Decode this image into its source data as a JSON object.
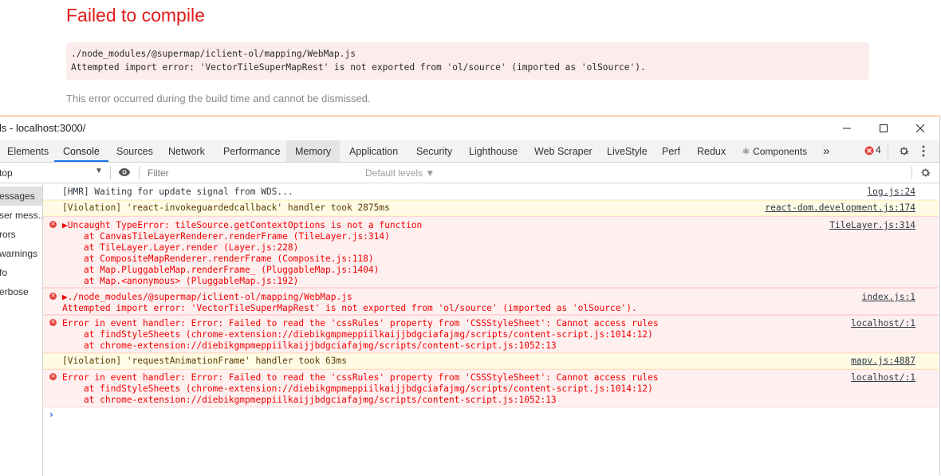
{
  "overlay": {
    "title": "Failed to compile",
    "error_lines": [
      "./node_modules/@supermap/iclient-ol/mapping/WebMap.js",
      "Attempted import error: 'VectorTileSuperMapRest' is not exported from 'ol/source' (imported as 'olSource')."
    ],
    "note": "This error occurred during the build time and cannot be dismissed."
  },
  "window": {
    "title": "ls - localhost:3000/",
    "controls": {
      "minimize": "—",
      "maximize": "☐",
      "close": "✕"
    }
  },
  "tabs": [
    "Elements",
    "Console",
    "Sources",
    "Network",
    "Performance",
    "Memory",
    "Application",
    "Security",
    "Lighthouse",
    "Web Scraper",
    "LiveStyle",
    "Perf",
    "Redux",
    "⚛ Components",
    "»"
  ],
  "active_tab": "Console",
  "error_count": "4",
  "filter": {
    "context": "top",
    "placeholder": "Filter",
    "levels": "Default levels ▼"
  },
  "sidebar": [
    "essages",
    "ser mess...",
    "rors",
    "warnings",
    "fo",
    "erbose"
  ],
  "messages": [
    {
      "type": "log",
      "lines": [
        "[HMR] Waiting for update signal from WDS..."
      ],
      "source": "log.js:24"
    },
    {
      "type": "warn",
      "lines": [
        "[Violation] 'react-invokeguardedcallback' handler took 2875ms"
      ],
      "source": "react-dom.development.js:174"
    },
    {
      "type": "error",
      "lines": [
        "▶Uncaught TypeError: tileSource.getContextOptions is not a function",
        "    at CanvasTileLayerRenderer.renderFrame (TileLayer.js:314)",
        "    at TileLayer.Layer.render (Layer.js:228)",
        "    at CompositeMapRenderer.renderFrame (Composite.js:118)",
        "    at Map.PluggableMap.renderFrame_ (PluggableMap.js:1404)",
        "    at Map.<anonymous> (PluggableMap.js:192)"
      ],
      "source": "TileLayer.js:314"
    },
    {
      "type": "error",
      "lines": [
        "▶./node_modules/@supermap/iclient-ol/mapping/WebMap.js",
        "Attempted import error: 'VectorTileSuperMapRest' is not exported from 'ol/source' (imported as 'olSource')."
      ],
      "source": "index.js:1"
    },
    {
      "type": "error",
      "lines": [
        "Error in event handler: Error: Failed to read the 'cssRules' property from 'CSSStyleSheet': Cannot access rules",
        "    at findStyleSheets (chrome-extension://diebikgmpmeppiilkaijjbdgciafajmg/scripts/content-script.js:1014:12)",
        "    at chrome-extension://diebikgmpmeppiilkaijjbdgciafajmg/scripts/content-script.js:1052:13"
      ],
      "source": "localhost/:1"
    },
    {
      "type": "warn",
      "lines": [
        "[Violation] 'requestAnimationFrame' handler took 63ms"
      ],
      "source": "mapv.js:4887"
    },
    {
      "type": "error",
      "lines": [
        "Error in event handler: Error: Failed to read the 'cssRules' property from 'CSSStyleSheet': Cannot access rules",
        "    at findStyleSheets (chrome-extension://diebikgmpmeppiilkaijjbdgciafajmg/scripts/content-script.js:1014:12)",
        "    at chrome-extension://diebikgmpmeppiilkaijjbdgciafajmg/scripts/content-script.js:1052:13"
      ],
      "source": "localhost/:1"
    }
  ],
  "prompt": "›",
  "colors": {
    "error_text": "#f20000",
    "error_bg": "#fff0f0",
    "warn_bg": "#fffbe5",
    "accent": "#1a73e8",
    "overlay_title": "#e21b1b"
  }
}
